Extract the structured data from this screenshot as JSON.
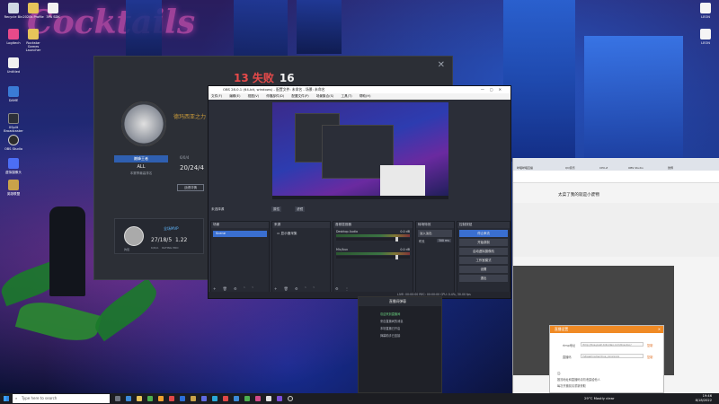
{
  "desktop": {
    "icons_left": [
      {
        "label": "Recycle Bin"
      },
      {
        "label": "2020s Profile"
      },
      {
        "label": "3PA SDK"
      },
      {
        "label": "Logitech"
      },
      {
        "label": "Rockstar Games Launcher"
      },
      {
        "label": "Untitled"
      },
      {
        "label": "DAME"
      },
      {
        "label": "XSplit Broadcaster"
      },
      {
        "label": "OBS Studio"
      },
      {
        "label": "虚拟摄像头"
      },
      {
        "label": "英雄联盟"
      }
    ],
    "icons_right": [
      {
        "label": "LEON"
      },
      {
        "label": "LEON"
      }
    ]
  },
  "game_window": {
    "score_red": "13 失败",
    "score_white": "16",
    "player_name": "德玛西亚之力",
    "rank_badge": "巅峰王者",
    "rank": "ALL",
    "rank_sub": "本赛季最高排名",
    "stat_small": "6/0/4",
    "stat_big": "20/24/4",
    "stat_label": "战绩详情",
    "mvp": {
      "title": "全场MVP",
      "score": "27/18/5",
      "rating": "1.22",
      "rating_label": "RATING PRO",
      "kda_label": "K/D/A",
      "name": "狗蛋"
    }
  },
  "obs": {
    "title": "OBS 28.0.1 (64-bit, windows) - 配置文件: 未命名 - 场景: 未命名",
    "menu": [
      "文件(F)",
      "编辑(E)",
      "视图(V)",
      "停靠部件(D)",
      "配置文件(P)",
      "场景集合(S)",
      "工具(T)",
      "帮助(H)"
    ],
    "source_bar": {
      "label": "未选择源",
      "properties": "属性",
      "filters": "滤镜"
    },
    "docks": {
      "scenes": "场景",
      "sources": "来源",
      "mixer": "音频混音器",
      "transitions": "转场特效",
      "controls": "控制按钮"
    },
    "scene_item": "Scene",
    "source_item": "显示器采集",
    "mixer": [
      {
        "name": "Desktop Audio",
        "db": "0.0 dB"
      },
      {
        "name": "Mic/Aux",
        "db": "0.0 dB"
      }
    ],
    "transitions": {
      "type": "淡入淡出",
      "duration_label": "时长",
      "duration": "300 ms"
    },
    "controls": [
      "停止串流",
      "开始录制",
      "启动虚拟摄像机",
      "工作室模式",
      "设置",
      "退出"
    ],
    "status": "LIVE: 00:00:00    REC: 00:00:00    CPU: 0.4%, 30.00 fps"
  },
  "browser": {
    "tabs": [
      "哔哩哔哩直播",
      "QQ音乐",
      "CPU-Z",
      "OBS Studio",
      "微博"
    ],
    "page_title": "太菜了我的就是小废物"
  },
  "chat": {
    "title": "直播间弹幕",
    "lines": [
      "来自直播间的消息",
      "本场直播已开启",
      "弹幕助手已连接"
    ],
    "highlight": "欢迎来到直播间"
  },
  "dialog": {
    "title": "直播设置",
    "server_label": "rtmp地址",
    "server_value": "rtmp://live-push.bilivideo.com/live-bvc/",
    "key_label": "直播码",
    "key_value": "?streamname=live_xxxxxxxx",
    "link_text": "复制",
    "note_label": "注:",
    "note_1": "推流地址和直播码请勿泄露给他人",
    "note_2": "每次开播前请重新获取"
  },
  "taskbar": {
    "search_placeholder": "Type here to search",
    "weather": "29°C Mostly clear",
    "time": "19:46",
    "date": "8/18/2022"
  }
}
